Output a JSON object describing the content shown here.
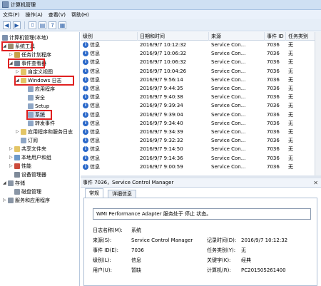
{
  "window": {
    "title": "计算机管理"
  },
  "menu": [
    "文件(F)",
    "操作(A)",
    "查看(V)",
    "帮助(H)"
  ],
  "tree": [
    {
      "label": "计算机管理(本地)",
      "level": 0,
      "arrow": ""
    },
    {
      "label": "系统工具",
      "level": 1,
      "arrow": "◢"
    },
    {
      "label": "任务计划程序",
      "level": 2,
      "arrow": "▷"
    },
    {
      "label": "事件查看器",
      "level": 2,
      "arrow": "◢"
    },
    {
      "label": "自定义视图",
      "level": 3,
      "arrow": "▷"
    },
    {
      "label": "Windows 日志",
      "level": 3,
      "arrow": "◢"
    },
    {
      "label": "应用程序",
      "level": 4,
      "arrow": ""
    },
    {
      "label": "安全",
      "level": 4,
      "arrow": ""
    },
    {
      "label": "Setup",
      "level": 4,
      "arrow": ""
    },
    {
      "label": "系统",
      "level": 4,
      "arrow": ""
    },
    {
      "label": "转发事件",
      "level": 4,
      "arrow": ""
    },
    {
      "label": "应用程序和服务日志",
      "level": 3,
      "arrow": "▷"
    },
    {
      "label": "订阅",
      "level": 3,
      "arrow": ""
    },
    {
      "label": "共享文件夹",
      "level": 2,
      "arrow": "▷"
    },
    {
      "label": "本地用户和组",
      "level": 2,
      "arrow": "▷"
    },
    {
      "label": "性能",
      "level": 2,
      "arrow": "▷"
    },
    {
      "label": "设备管理器",
      "level": 2,
      "arrow": ""
    },
    {
      "label": "存储",
      "level": 1,
      "arrow": "◢"
    },
    {
      "label": "磁盘管理",
      "level": 2,
      "arrow": ""
    },
    {
      "label": "服务和应用程序",
      "level": 1,
      "arrow": "▷"
    }
  ],
  "table": {
    "headers": [
      "级别",
      "日期和时间",
      "来源",
      "事件 ID",
      "任务类别"
    ],
    "rows": [
      [
        "信息",
        "2016/9/7 10:12:32",
        "Service Con...",
        "7036",
        "无"
      ],
      [
        "信息",
        "2016/9/7 10:06:32",
        "Service Con...",
        "7036",
        "无"
      ],
      [
        "信息",
        "2016/9/7 10:06:32",
        "Service Con...",
        "7036",
        "无"
      ],
      [
        "信息",
        "2016/9/7 10:04:26",
        "Service Con...",
        "7036",
        "无"
      ],
      [
        "信息",
        "2016/9/7 9:56:14",
        "Service Con...",
        "7036",
        "无"
      ],
      [
        "信息",
        "2016/9/7 9:44:35",
        "Service Con...",
        "7036",
        "无"
      ],
      [
        "信息",
        "2016/9/7 9:40:38",
        "Service Con...",
        "7036",
        "无"
      ],
      [
        "信息",
        "2016/9/7 9:39:34",
        "Service Con...",
        "7036",
        "无"
      ],
      [
        "信息",
        "2016/9/7 9:39:04",
        "Service Con...",
        "7036",
        "无"
      ],
      [
        "信息",
        "2016/9/7 9:34:40",
        "Service Con...",
        "7036",
        "无"
      ],
      [
        "信息",
        "2016/9/7 9:34:39",
        "Service Con...",
        "7036",
        "无"
      ],
      [
        "信息",
        "2016/9/7 9:32:32",
        "Service Con...",
        "7036",
        "无"
      ],
      [
        "信息",
        "2016/9/7 9:14:50",
        "Service Con...",
        "7036",
        "无"
      ],
      [
        "信息",
        "2016/9/7 9:14:36",
        "Service Con...",
        "7036",
        "无"
      ],
      [
        "信息",
        "2016/9/7 9:00:59",
        "Service Con...",
        "7036",
        "无"
      ]
    ]
  },
  "detail": {
    "header": "事件 7036，Service Control Manager",
    "tabs": [
      "常规",
      "详细信息"
    ],
    "message": "WMI Performance Adapter 服务处于 停止 状态。",
    "fields": {
      "log_name_label": "日志名称(M):",
      "log_name": "系统",
      "source_label": "来源(S):",
      "source": "Service Control Manager",
      "logged_label": "记录时间(D):",
      "logged": "2016/9/7 10:12:32",
      "event_id_label": "事件 ID(E):",
      "event_id": "7036",
      "task_label": "任务类别(Y):",
      "task": "无",
      "level_label": "级别(L):",
      "level": "信息",
      "keywords_label": "关键字(K):",
      "keywords": "经典",
      "user_label": "用户(U):",
      "user": "暂缺",
      "computer_label": "计算机(R):",
      "computer": "PC201505261400"
    }
  }
}
